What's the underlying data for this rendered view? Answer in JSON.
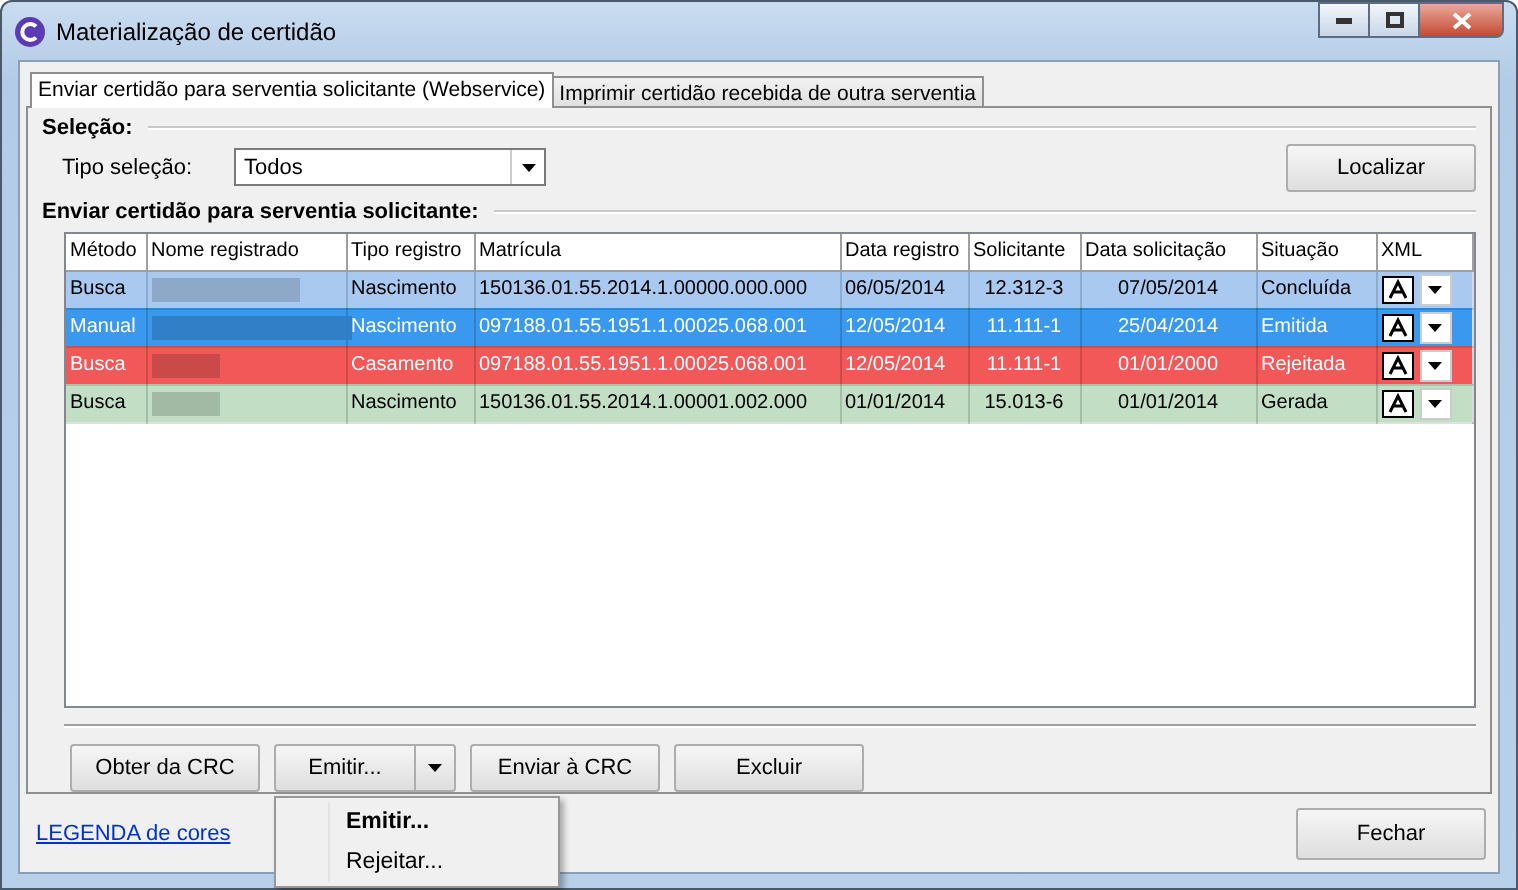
{
  "window": {
    "title": "Materialização de certidão"
  },
  "tabs": [
    {
      "label": "Enviar certidão para serventia solicitante (Webservice)",
      "selected": true
    },
    {
      "label": "Imprimir certidão recebida de outra serventia",
      "selected": false
    }
  ],
  "selection": {
    "heading": "Seleção:",
    "label": "Tipo seleção:",
    "value": "Todos",
    "search_button": "Localizar"
  },
  "grid": {
    "heading": "Enviar certidão para serventia solicitante:",
    "columns": [
      "Método",
      "Nome registrado",
      "Tipo registro",
      "Matrícula",
      "Data registro",
      "Solicitante",
      "Data solicitação",
      "Situação",
      "XML"
    ],
    "rows": [
      {
        "color": "#a9c9f0",
        "light_text": false,
        "cells": [
          "Busca",
          "",
          "Nascimento",
          "150136.01.55.2014.1.00000.000.000",
          "06/05/2014",
          "12.312-3",
          "07/05/2014",
          "Concluída"
        ]
      },
      {
        "color": "#3a98ee",
        "light_text": true,
        "cells": [
          "Manual",
          "",
          "Nascimento",
          "097188.01.55.1951.1.00025.068.001",
          "12/05/2014",
          "11.111-1",
          "25/04/2014",
          "Emitida"
        ]
      },
      {
        "color": "#f25858",
        "light_text": true,
        "cells": [
          "Busca",
          "",
          "Casamento",
          "097188.01.55.1951.1.00025.068.001",
          "12/05/2014",
          "11.111-1",
          "01/01/2000",
          "Rejeitada"
        ]
      },
      {
        "color": "#c2dec4",
        "light_text": false,
        "cells": [
          "Busca",
          "",
          "Nascimento",
          "150136.01.55.2014.1.00001.002.000",
          "01/01/2014",
          "15.013-6",
          "01/01/2014",
          "Gerada"
        ]
      }
    ]
  },
  "toolbar": {
    "buttons": [
      "Obter da CRC",
      "Emitir...",
      "Enviar à CRC",
      "Excluir"
    ]
  },
  "menu": {
    "open": true,
    "items": [
      {
        "label": "Emitir...",
        "default": true
      },
      {
        "label": "Rejeitar...",
        "default": false
      }
    ]
  },
  "footer": {
    "link": "LEGENDA de cores",
    "close_button": "Fechar"
  }
}
